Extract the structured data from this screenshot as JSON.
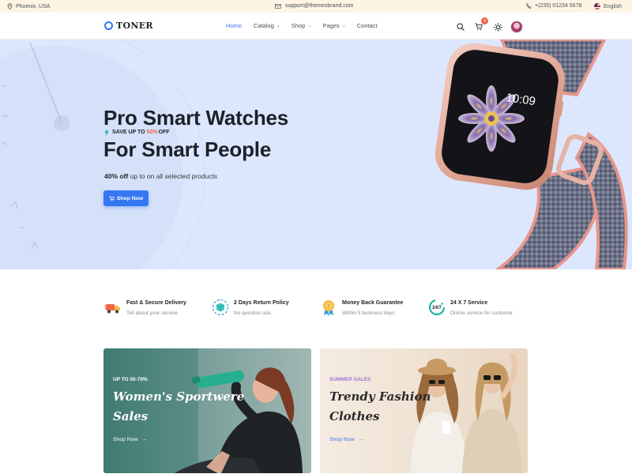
{
  "topbar": {
    "location": "Phoenix, USA",
    "email": "support@themesbrand.com",
    "phone": "+(235) 01234 5678",
    "language": "English"
  },
  "navbar": {
    "logo_text": "TONER",
    "menu": [
      {
        "label": "Home",
        "active": true,
        "has_dropdown": false
      },
      {
        "label": "Catalog",
        "active": false,
        "has_dropdown": true
      },
      {
        "label": "Shop",
        "active": false,
        "has_dropdown": true
      },
      {
        "label": "Pages",
        "active": false,
        "has_dropdown": true
      },
      {
        "label": "Contact",
        "active": false,
        "has_dropdown": false
      }
    ],
    "cart_count": "4",
    "icons": [
      "search-icon",
      "cart-icon",
      "theme-toggle-icon",
      "user-avatar"
    ]
  },
  "hero": {
    "promo_prefix": "SAVE UP TO",
    "promo_highlight": "50%",
    "promo_suffix": "OFF",
    "title_line1": "Pro Smart Watches",
    "title_line2": "For Smart People",
    "subtitle_bold": "40% off",
    "subtitle_rest": "up to on all selected products",
    "cta_label": "Shop Now",
    "watch_time": "10:09"
  },
  "features": [
    {
      "title": "Fast & Secure Delivery",
      "desc": "Tell about your service.",
      "icon": "delivery-truck-icon"
    },
    {
      "title": "2 Days Return Policy",
      "desc": "No question ask.",
      "icon": "return-box-icon"
    },
    {
      "title": "Money Back Guarantee",
      "desc": "Within 5 business days",
      "icon": "medal-badge-icon"
    },
    {
      "title": "24 X 7 Service",
      "desc": "Online service for customer",
      "icon": "support-24-7-icon"
    }
  ],
  "promo_cards": [
    {
      "kicker": "UP TO 50-70%",
      "title_line1": "Women's Sportwere",
      "title_line2": "Sales",
      "link": "Shop Now"
    },
    {
      "kicker": "SUMMER SALES",
      "title_line1": "Trendy Fashion",
      "title_line2": "Clothes",
      "link": "Shop Now"
    }
  ],
  "colors": {
    "primary": "#3577f1",
    "hero_bg": "#dce7fd",
    "topbar_bg": "#fdf4e3",
    "badge": "#f06548",
    "summer_kicker": "#a174d9"
  }
}
